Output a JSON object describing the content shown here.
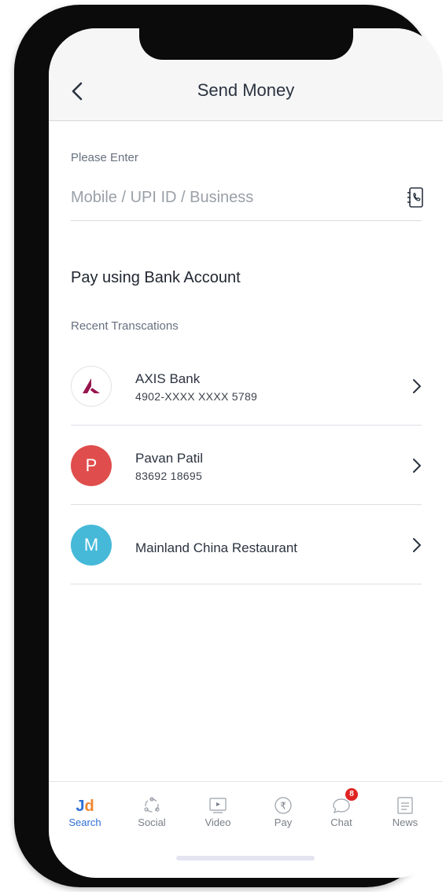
{
  "header": {
    "title": "Send Money"
  },
  "recipient_input": {
    "label": "Please Enter",
    "placeholder": "Mobile / UPI ID / Business",
    "value": ""
  },
  "section": {
    "title": "Pay using Bank Account",
    "recent_label": "Recent Transcations"
  },
  "recent": [
    {
      "name": "AXIS Bank",
      "detail": "4902-XXXX XXXX 5789",
      "avatar_letter": "",
      "avatar_icon": "axis-bank-logo-icon",
      "avatar_color": "#97144d"
    },
    {
      "name": "Pavan Patil",
      "detail": "83692 18695",
      "avatar_letter": "P",
      "avatar_color": "#df4e4c"
    },
    {
      "name": "Mainland China Restaurant",
      "detail": "",
      "avatar_letter": "M",
      "avatar_color": "#46b9d9"
    }
  ],
  "tabs": [
    {
      "label": "Search",
      "icon": "jd-logo-icon",
      "active": true
    },
    {
      "label": "Social",
      "icon": "social-icon"
    },
    {
      "label": "Video",
      "icon": "video-icon"
    },
    {
      "label": "Pay",
      "icon": "rupee-icon"
    },
    {
      "label": "Chat",
      "icon": "chat-icon",
      "badge": "8"
    },
    {
      "label": "News",
      "icon": "news-icon"
    }
  ],
  "jd_logo": {
    "j": "J",
    "d": "d"
  },
  "colors": {
    "accent": "#2f6fd6",
    "jd_j": "#2f6fd6",
    "jd_d": "#f0862e",
    "badge": "#e02424"
  }
}
